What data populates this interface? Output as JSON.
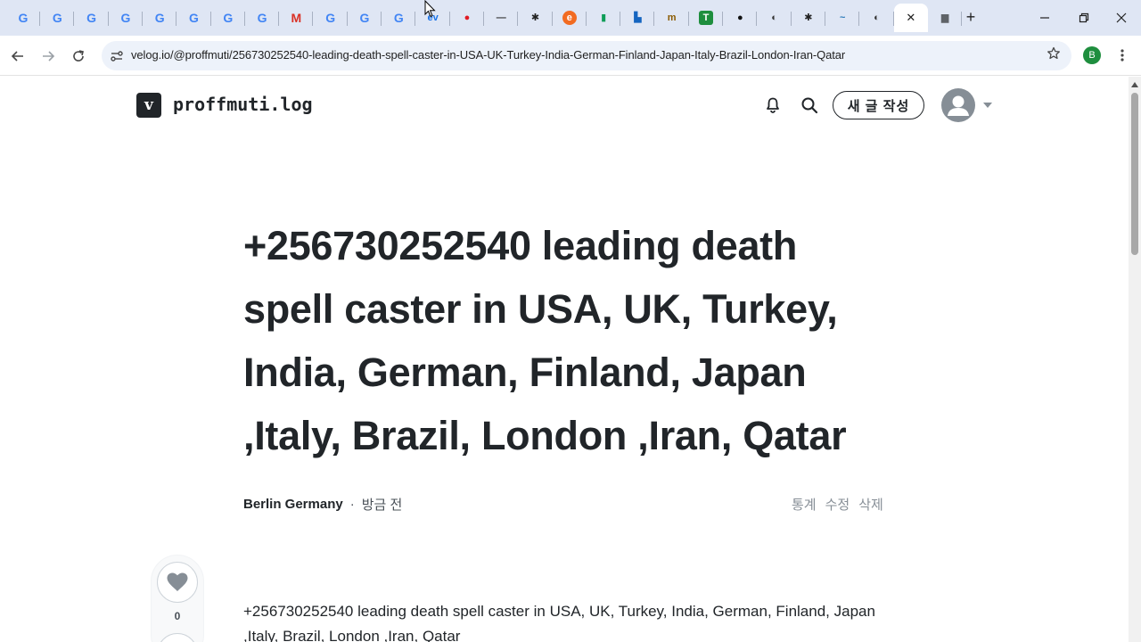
{
  "browser": {
    "tabs": [
      {
        "icon": "google-icon",
        "glyph": "G"
      },
      {
        "icon": "google-icon",
        "glyph": "G"
      },
      {
        "icon": "google-icon",
        "glyph": "G"
      },
      {
        "icon": "google-icon",
        "glyph": "G"
      },
      {
        "icon": "google-icon",
        "glyph": "G"
      },
      {
        "icon": "google-icon",
        "glyph": "G"
      },
      {
        "icon": "google-icon",
        "glyph": "G"
      },
      {
        "icon": "google-icon",
        "glyph": "G"
      },
      {
        "icon": "gmail-icon",
        "glyph": "M"
      },
      {
        "icon": "google-icon",
        "glyph": "G"
      },
      {
        "icon": "google-icon",
        "glyph": "G"
      },
      {
        "icon": "google-icon",
        "glyph": "G"
      },
      {
        "icon": "site-ev-icon",
        "glyph": "ev"
      },
      {
        "icon": "red-circle-icon",
        "glyph": "●"
      },
      {
        "icon": "site-dash-icon",
        "glyph": "—"
      },
      {
        "icon": "asterisk-icon",
        "glyph": "✱"
      },
      {
        "icon": "orange-e-icon",
        "glyph": "e"
      },
      {
        "icon": "book-icon",
        "glyph": "▮"
      },
      {
        "icon": "chart-icon",
        "glyph": "▙"
      },
      {
        "icon": "site-m-icon",
        "glyph": "m"
      },
      {
        "icon": "t-icon",
        "glyph": "T"
      },
      {
        "icon": "dark-circle-icon",
        "glyph": "●"
      },
      {
        "icon": "globe-icon",
        "glyph": "◐"
      },
      {
        "icon": "asterisk-icon",
        "glyph": "✱"
      },
      {
        "icon": "wave-icon",
        "glyph": "~"
      },
      {
        "icon": "globe-icon",
        "glyph": "◐"
      },
      {
        "icon": "close-icon",
        "glyph": "✕",
        "active": true
      },
      {
        "icon": "image-icon",
        "glyph": "▆"
      }
    ],
    "new_tab": "+",
    "url": "velog.io/@proffmuti/256730252540-leading-death-spell-caster-in-USA-UK-Turkey-India-German-Finland-Japan-Italy-Brazil-London-Iran-Qatar",
    "profile_initial": "B"
  },
  "header": {
    "logo_letter": "v",
    "blog_title": "proffmuti.log",
    "write_button": "새 글 작성"
  },
  "post": {
    "title": "+256730252540 leading death spell caster in USA, UK, Turkey, India, German, Finland, Japan ,Italy, Brazil, London ,Iran, Qatar",
    "author": "Berlin Germany",
    "separator": "·",
    "time": "방금 전",
    "actions": [
      "통계",
      "수정",
      "삭제"
    ],
    "likes": "0",
    "body": "+256730252540 leading death spell caster in USA, UK, Turkey, India, German, Finland, Japan ,Italy, Brazil, London ,Iran, Qatar"
  }
}
